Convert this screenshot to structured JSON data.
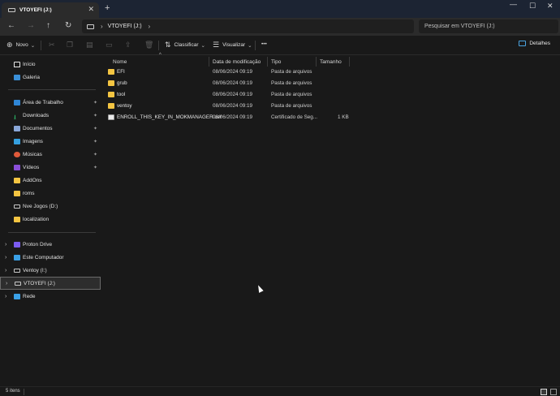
{
  "tab": {
    "title": "VTOYEFI (J:)",
    "close": "✕",
    "new": "+"
  },
  "window": {
    "minimize": "—",
    "maximize": "☐",
    "close": "✕"
  },
  "nav": {
    "back": "←",
    "forward": "→",
    "up": "↑",
    "refresh": "↻"
  },
  "address": {
    "sep1": "›",
    "crumb": "VTOYEFI (J:)",
    "sep2": "›"
  },
  "search": {
    "placeholder": "Pesquisar em VTOYEFI (J:)"
  },
  "command": {
    "new_label": "Novo",
    "new_icon": "⊕",
    "sort_label": "Classificar",
    "view_label": "Visualizar",
    "more": "•••",
    "details_label": "Detalhes",
    "caret": "⌄"
  },
  "sidebar": {
    "quick": [
      {
        "label": "Início",
        "icon": "home-icon"
      },
      {
        "label": "Galeria",
        "icon": "gallery-icon"
      }
    ],
    "pinned": [
      {
        "label": "Área de Trabalho",
        "icon": "desktop-icon",
        "pinned": true
      },
      {
        "label": "Downloads",
        "icon": "downloads-icon",
        "pinned": true
      },
      {
        "label": "Documentos",
        "icon": "documents-icon",
        "pinned": true
      },
      {
        "label": "Imagens",
        "icon": "images-icon",
        "pinned": true
      },
      {
        "label": "Músicas",
        "icon": "music-icon",
        "pinned": true
      },
      {
        "label": "Vídeos",
        "icon": "videos-icon",
        "pinned": true
      },
      {
        "label": "AddOns",
        "icon": "folder-icon",
        "pinned": false
      },
      {
        "label": "roms",
        "icon": "folder-icon",
        "pinned": false
      },
      {
        "label": "Nve Jogos (D:)",
        "icon": "drive-icon",
        "pinned": false
      },
      {
        "label": "localization",
        "icon": "folder-icon",
        "pinned": false
      }
    ],
    "tree": [
      {
        "label": "Proton Drive",
        "icon": "proton-drive-icon"
      },
      {
        "label": "Este Computador",
        "icon": "computer-icon"
      },
      {
        "label": "Ventoy (I:)",
        "icon": "drive-icon"
      },
      {
        "label": "VTOYEFI (J:)",
        "icon": "drive-icon",
        "selected": true
      },
      {
        "label": "Rede",
        "icon": "network-icon"
      }
    ],
    "chevron": "›",
    "pin_glyph": "📌"
  },
  "columns": {
    "name": "Nome",
    "modified": "Data de modificação",
    "type": "Tipo",
    "size": "Tamanho",
    "sort_caret": "^"
  },
  "files": [
    {
      "name": "EFI",
      "modified": "08/06/2024 09:19",
      "type": "Pasta de arquivos",
      "size": "",
      "kind": "folder"
    },
    {
      "name": "grub",
      "modified": "08/06/2024 09:19",
      "type": "Pasta de arquivos",
      "size": "",
      "kind": "folder"
    },
    {
      "name": "tool",
      "modified": "08/06/2024 09:19",
      "type": "Pasta de arquivos",
      "size": "",
      "kind": "folder"
    },
    {
      "name": "ventoy",
      "modified": "08/06/2024 09:19",
      "type": "Pasta de arquivos",
      "size": "",
      "kind": "folder"
    },
    {
      "name": "ENROLL_THIS_KEY_IN_MOKMANAGER.cer",
      "modified": "08/06/2024 09:19",
      "type": "Certificado de Seg...",
      "size": "1 KB",
      "kind": "certificate"
    }
  ],
  "status": {
    "count": "5 itens"
  }
}
